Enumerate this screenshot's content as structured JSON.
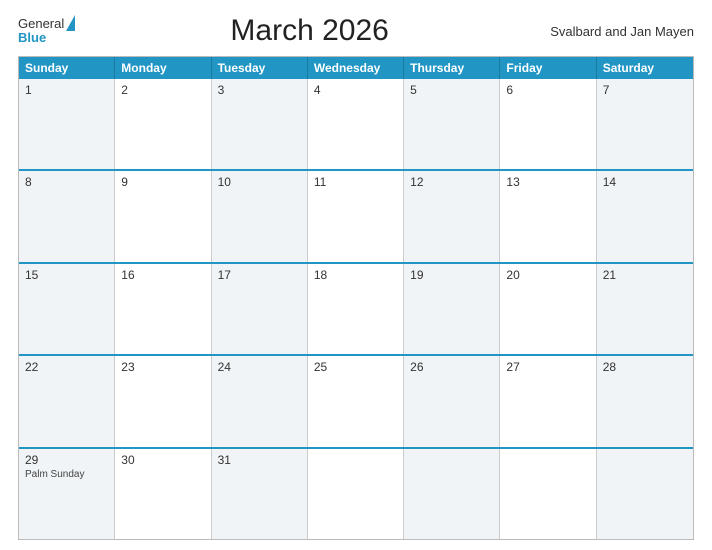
{
  "header": {
    "logo_line1": "General",
    "logo_line2": "Blue",
    "title": "March 2026",
    "region": "Svalbard and Jan Mayen"
  },
  "calendar": {
    "days_of_week": [
      "Sunday",
      "Monday",
      "Tuesday",
      "Wednesday",
      "Thursday",
      "Friday",
      "Saturday"
    ],
    "weeks": [
      [
        {
          "num": "1",
          "shade": true,
          "events": []
        },
        {
          "num": "2",
          "shade": false,
          "events": []
        },
        {
          "num": "3",
          "shade": true,
          "events": []
        },
        {
          "num": "4",
          "shade": false,
          "events": []
        },
        {
          "num": "5",
          "shade": true,
          "events": []
        },
        {
          "num": "6",
          "shade": false,
          "events": []
        },
        {
          "num": "7",
          "shade": true,
          "events": []
        }
      ],
      [
        {
          "num": "8",
          "shade": true,
          "events": []
        },
        {
          "num": "9",
          "shade": false,
          "events": []
        },
        {
          "num": "10",
          "shade": true,
          "events": []
        },
        {
          "num": "11",
          "shade": false,
          "events": []
        },
        {
          "num": "12",
          "shade": true,
          "events": []
        },
        {
          "num": "13",
          "shade": false,
          "events": []
        },
        {
          "num": "14",
          "shade": true,
          "events": []
        }
      ],
      [
        {
          "num": "15",
          "shade": true,
          "events": []
        },
        {
          "num": "16",
          "shade": false,
          "events": []
        },
        {
          "num": "17",
          "shade": true,
          "events": []
        },
        {
          "num": "18",
          "shade": false,
          "events": []
        },
        {
          "num": "19",
          "shade": true,
          "events": []
        },
        {
          "num": "20",
          "shade": false,
          "events": []
        },
        {
          "num": "21",
          "shade": true,
          "events": []
        }
      ],
      [
        {
          "num": "22",
          "shade": true,
          "events": []
        },
        {
          "num": "23",
          "shade": false,
          "events": []
        },
        {
          "num": "24",
          "shade": true,
          "events": []
        },
        {
          "num": "25",
          "shade": false,
          "events": []
        },
        {
          "num": "26",
          "shade": true,
          "events": []
        },
        {
          "num": "27",
          "shade": false,
          "events": []
        },
        {
          "num": "28",
          "shade": true,
          "events": []
        }
      ],
      [
        {
          "num": "29",
          "shade": true,
          "events": [
            "Palm Sunday"
          ]
        },
        {
          "num": "30",
          "shade": false,
          "events": []
        },
        {
          "num": "31",
          "shade": true,
          "events": []
        },
        {
          "num": "",
          "shade": false,
          "events": []
        },
        {
          "num": "",
          "shade": true,
          "events": []
        },
        {
          "num": "",
          "shade": false,
          "events": []
        },
        {
          "num": "",
          "shade": true,
          "events": []
        }
      ]
    ]
  }
}
